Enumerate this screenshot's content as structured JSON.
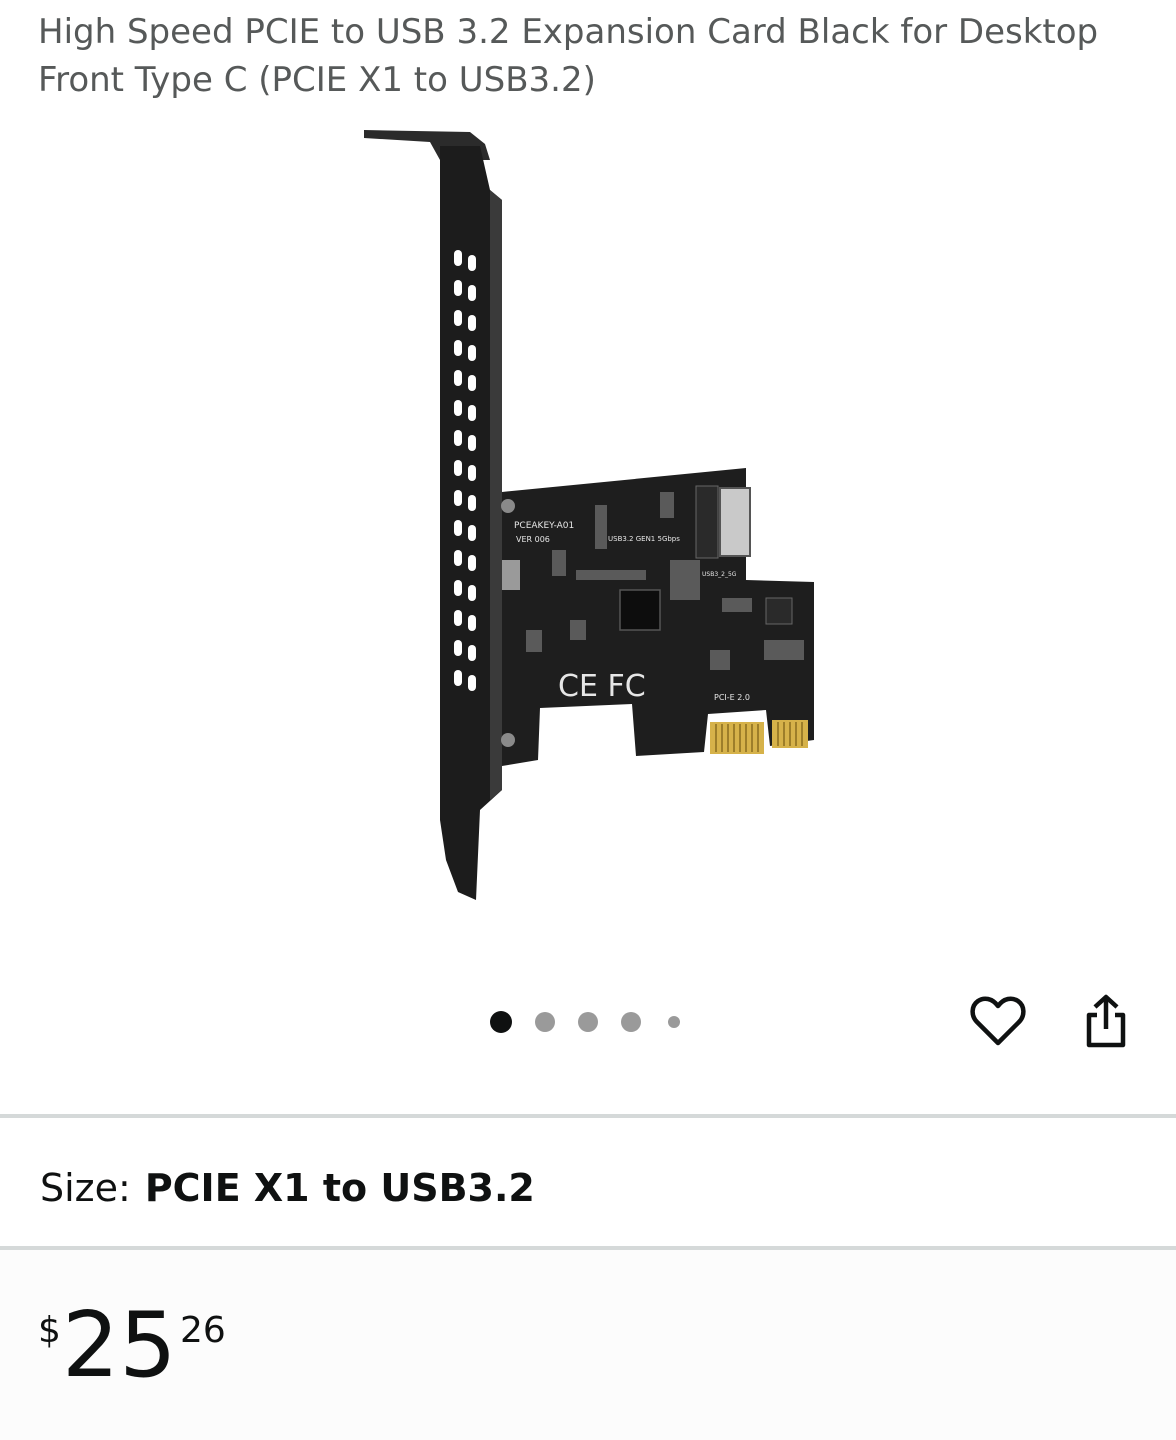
{
  "product": {
    "title": "High Speed PCIE to USB 3.2 Expansion Card Black for Desktop Front Type C (PCIE X1 to USB3.2)"
  },
  "image": {
    "pcb_labels": {
      "model": "PCEAKEY-A01",
      "version": "VER 006",
      "usb": "USB3.2 GEN1 5Gbps",
      "header": "USB3_2_5G",
      "bus": "PCI-E 2.0",
      "marks": "CE FC"
    },
    "carousel": {
      "count": 5,
      "active_index": 0
    }
  },
  "actions": {
    "wishlist_icon": "heart-icon",
    "share_icon": "share-icon"
  },
  "size": {
    "label": "Size:",
    "value": "PCIE X1 to USB3.2"
  },
  "price": {
    "symbol": "$",
    "whole": "25",
    "fraction": "26"
  },
  "colors": {
    "title_gray": "#565959",
    "divider": "#d5d9d9",
    "dot_active": "#0f1111",
    "dot_inactive": "#9a9a9a"
  }
}
